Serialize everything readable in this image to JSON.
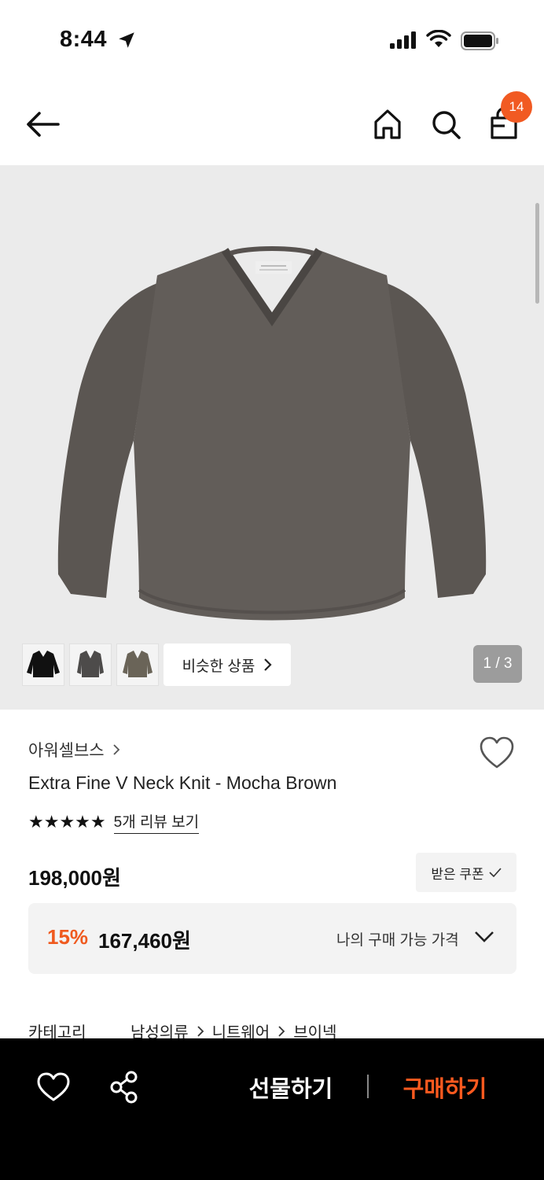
{
  "status_bar": {
    "time": "8:44",
    "icons": [
      "location-arrow-icon",
      "cellular-signal-icon",
      "wifi-icon",
      "battery-icon"
    ]
  },
  "header": {
    "icons": [
      "back-arrow-icon",
      "home-icon",
      "search-icon",
      "shopping-bag-icon"
    ],
    "cart_count": "14"
  },
  "gallery": {
    "similar_label": "비슷한 상품",
    "page_indicator": "1 / 3",
    "thumbnails": [
      "black sweater",
      "charcoal sweater",
      "mocha brown sweater"
    ]
  },
  "product": {
    "brand": "아워셀브스",
    "name": "Extra Fine V Neck Knit - Mocha Brown",
    "stars": "★★★★★",
    "rating": 5,
    "review_link": "5개 리뷰 보기",
    "price": "198,000원",
    "coupon_label": "받은 쿠폰",
    "discount_rate": "15%",
    "discount_price": "167,460원",
    "my_price_label": "나의 구매 가능 가격",
    "category_label": "카테고리",
    "category_path": [
      "남성의류",
      "니트웨어",
      "브이넥"
    ]
  },
  "bottom_bar": {
    "gift_label": "선물하기",
    "buy_label": "구매하기"
  },
  "colors": {
    "accent": "#ef5a1f",
    "badge": "#f15a22",
    "bottom_bar_bg": "#000000",
    "gallery_bg": "#ebebeb"
  }
}
